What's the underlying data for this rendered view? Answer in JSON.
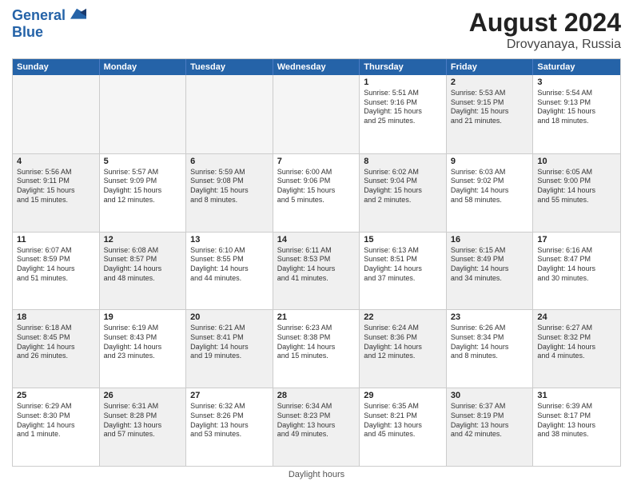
{
  "header": {
    "logo_line1": "General",
    "logo_line2": "Blue",
    "month": "August 2024",
    "location": "Drovyanaya, Russia"
  },
  "weekdays": [
    "Sunday",
    "Monday",
    "Tuesday",
    "Wednesday",
    "Thursday",
    "Friday",
    "Saturday"
  ],
  "footer": "Daylight hours",
  "weeks": [
    [
      {
        "day": "",
        "empty": true
      },
      {
        "day": "",
        "empty": true
      },
      {
        "day": "",
        "empty": true
      },
      {
        "day": "",
        "empty": true
      },
      {
        "day": "1",
        "lines": [
          "Sunrise: 5:51 AM",
          "Sunset: 9:16 PM",
          "Daylight: 15 hours",
          "and 25 minutes."
        ]
      },
      {
        "day": "2",
        "shaded": true,
        "lines": [
          "Sunrise: 5:53 AM",
          "Sunset: 9:15 PM",
          "Daylight: 15 hours",
          "and 21 minutes."
        ]
      },
      {
        "day": "3",
        "lines": [
          "Sunrise: 5:54 AM",
          "Sunset: 9:13 PM",
          "Daylight: 15 hours",
          "and 18 minutes."
        ]
      }
    ],
    [
      {
        "day": "4",
        "shaded": true,
        "lines": [
          "Sunrise: 5:56 AM",
          "Sunset: 9:11 PM",
          "Daylight: 15 hours",
          "and 15 minutes."
        ]
      },
      {
        "day": "5",
        "lines": [
          "Sunrise: 5:57 AM",
          "Sunset: 9:09 PM",
          "Daylight: 15 hours",
          "and 12 minutes."
        ]
      },
      {
        "day": "6",
        "shaded": true,
        "lines": [
          "Sunrise: 5:59 AM",
          "Sunset: 9:08 PM",
          "Daylight: 15 hours",
          "and 8 minutes."
        ]
      },
      {
        "day": "7",
        "lines": [
          "Sunrise: 6:00 AM",
          "Sunset: 9:06 PM",
          "Daylight: 15 hours",
          "and 5 minutes."
        ]
      },
      {
        "day": "8",
        "shaded": true,
        "lines": [
          "Sunrise: 6:02 AM",
          "Sunset: 9:04 PM",
          "Daylight: 15 hours",
          "and 2 minutes."
        ]
      },
      {
        "day": "9",
        "lines": [
          "Sunrise: 6:03 AM",
          "Sunset: 9:02 PM",
          "Daylight: 14 hours",
          "and 58 minutes."
        ]
      },
      {
        "day": "10",
        "shaded": true,
        "lines": [
          "Sunrise: 6:05 AM",
          "Sunset: 9:00 PM",
          "Daylight: 14 hours",
          "and 55 minutes."
        ]
      }
    ],
    [
      {
        "day": "11",
        "lines": [
          "Sunrise: 6:07 AM",
          "Sunset: 8:59 PM",
          "Daylight: 14 hours",
          "and 51 minutes."
        ]
      },
      {
        "day": "12",
        "shaded": true,
        "lines": [
          "Sunrise: 6:08 AM",
          "Sunset: 8:57 PM",
          "Daylight: 14 hours",
          "and 48 minutes."
        ]
      },
      {
        "day": "13",
        "lines": [
          "Sunrise: 6:10 AM",
          "Sunset: 8:55 PM",
          "Daylight: 14 hours",
          "and 44 minutes."
        ]
      },
      {
        "day": "14",
        "shaded": true,
        "lines": [
          "Sunrise: 6:11 AM",
          "Sunset: 8:53 PM",
          "Daylight: 14 hours",
          "and 41 minutes."
        ]
      },
      {
        "day": "15",
        "lines": [
          "Sunrise: 6:13 AM",
          "Sunset: 8:51 PM",
          "Daylight: 14 hours",
          "and 37 minutes."
        ]
      },
      {
        "day": "16",
        "shaded": true,
        "lines": [
          "Sunrise: 6:15 AM",
          "Sunset: 8:49 PM",
          "Daylight: 14 hours",
          "and 34 minutes."
        ]
      },
      {
        "day": "17",
        "lines": [
          "Sunrise: 6:16 AM",
          "Sunset: 8:47 PM",
          "Daylight: 14 hours",
          "and 30 minutes."
        ]
      }
    ],
    [
      {
        "day": "18",
        "shaded": true,
        "lines": [
          "Sunrise: 6:18 AM",
          "Sunset: 8:45 PM",
          "Daylight: 14 hours",
          "and 26 minutes."
        ]
      },
      {
        "day": "19",
        "lines": [
          "Sunrise: 6:19 AM",
          "Sunset: 8:43 PM",
          "Daylight: 14 hours",
          "and 23 minutes."
        ]
      },
      {
        "day": "20",
        "shaded": true,
        "lines": [
          "Sunrise: 6:21 AM",
          "Sunset: 8:41 PM",
          "Daylight: 14 hours",
          "and 19 minutes."
        ]
      },
      {
        "day": "21",
        "lines": [
          "Sunrise: 6:23 AM",
          "Sunset: 8:38 PM",
          "Daylight: 14 hours",
          "and 15 minutes."
        ]
      },
      {
        "day": "22",
        "shaded": true,
        "lines": [
          "Sunrise: 6:24 AM",
          "Sunset: 8:36 PM",
          "Daylight: 14 hours",
          "and 12 minutes."
        ]
      },
      {
        "day": "23",
        "lines": [
          "Sunrise: 6:26 AM",
          "Sunset: 8:34 PM",
          "Daylight: 14 hours",
          "and 8 minutes."
        ]
      },
      {
        "day": "24",
        "shaded": true,
        "lines": [
          "Sunrise: 6:27 AM",
          "Sunset: 8:32 PM",
          "Daylight: 14 hours",
          "and 4 minutes."
        ]
      }
    ],
    [
      {
        "day": "25",
        "lines": [
          "Sunrise: 6:29 AM",
          "Sunset: 8:30 PM",
          "Daylight: 14 hours",
          "and 1 minute."
        ]
      },
      {
        "day": "26",
        "shaded": true,
        "lines": [
          "Sunrise: 6:31 AM",
          "Sunset: 8:28 PM",
          "Daylight: 13 hours",
          "and 57 minutes."
        ]
      },
      {
        "day": "27",
        "lines": [
          "Sunrise: 6:32 AM",
          "Sunset: 8:26 PM",
          "Daylight: 13 hours",
          "and 53 minutes."
        ]
      },
      {
        "day": "28",
        "shaded": true,
        "lines": [
          "Sunrise: 6:34 AM",
          "Sunset: 8:23 PM",
          "Daylight: 13 hours",
          "and 49 minutes."
        ]
      },
      {
        "day": "29",
        "lines": [
          "Sunrise: 6:35 AM",
          "Sunset: 8:21 PM",
          "Daylight: 13 hours",
          "and 45 minutes."
        ]
      },
      {
        "day": "30",
        "shaded": true,
        "lines": [
          "Sunrise: 6:37 AM",
          "Sunset: 8:19 PM",
          "Daylight: 13 hours",
          "and 42 minutes."
        ]
      },
      {
        "day": "31",
        "lines": [
          "Sunrise: 6:39 AM",
          "Sunset: 8:17 PM",
          "Daylight: 13 hours",
          "and 38 minutes."
        ]
      }
    ]
  ]
}
